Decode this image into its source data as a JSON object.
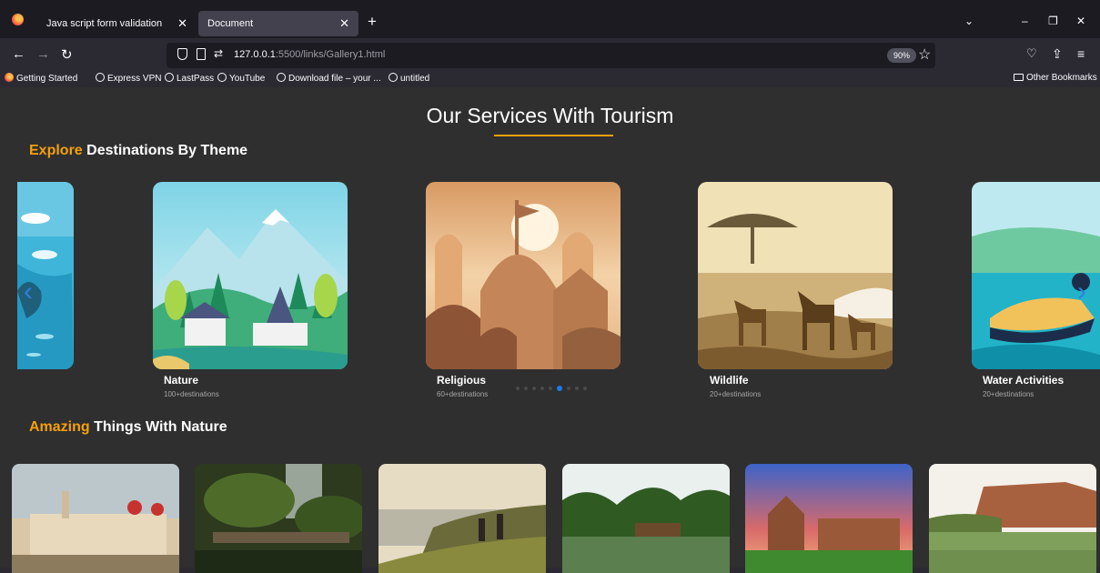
{
  "browser": {
    "tabs": [
      {
        "label": "Java script form validation"
      },
      {
        "label": "Document"
      }
    ],
    "url_host": "127.0.0.1",
    "url_rest": ":5500/links/Gallery1.html",
    "zoom": "90%",
    "bookmarks": [
      "Getting Started",
      "Express VPN",
      "LastPass",
      "YouTube",
      "Download file – your ...",
      "untitled"
    ],
    "other_bookmarks": "Other Bookmarks"
  },
  "page": {
    "title": "Our Services With Tourism",
    "section1": {
      "accent": "Explore",
      "rest": " Destinations By Theme"
    },
    "section2": {
      "accent": "Amazing",
      "rest": " Things With Nature"
    },
    "cards": [
      {
        "name": "Nature",
        "sub": "100+destinations"
      },
      {
        "name": "Religious",
        "sub": "60+destinations"
      },
      {
        "name": "Wildlife",
        "sub": "20+destinations"
      },
      {
        "name": "Water Activities",
        "sub": "20+destinations"
      }
    ],
    "slider": {
      "total_dots": 9,
      "active_dot": 6
    }
  },
  "colors": {
    "accent": "#f5a00b",
    "slider_active": "#1e7ae6",
    "page_bg": "#2f2f2f"
  }
}
